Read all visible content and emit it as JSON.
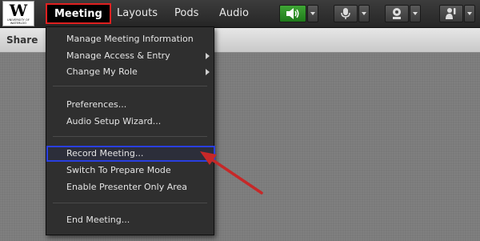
{
  "logo": {
    "letter": "W",
    "subtext": "UNIVERSITY OF WATERLOO"
  },
  "menubar": {
    "items": [
      {
        "label": "Meeting",
        "active": true
      },
      {
        "label": "Layouts"
      },
      {
        "label": "Pods"
      },
      {
        "label": "Audio"
      }
    ],
    "buttons": [
      {
        "name": "speaker-icon",
        "active": true
      },
      {
        "name": "microphone-icon"
      },
      {
        "name": "webcam-icon"
      },
      {
        "name": "raise-hand-icon"
      }
    ]
  },
  "pod": {
    "title": "Share"
  },
  "dropdown": {
    "items": [
      {
        "label": "Manage Meeting Information",
        "submenu": false
      },
      {
        "label": "Manage Access & Entry",
        "submenu": true
      },
      {
        "label": "Change My Role",
        "submenu": true
      },
      {
        "label": "Preferences...",
        "submenu": false
      },
      {
        "label": "Audio Setup Wizard...",
        "submenu": false
      },
      {
        "label": "Record Meeting...",
        "submenu": false,
        "highlighted": true
      },
      {
        "label": "Switch To Prepare Mode",
        "submenu": false
      },
      {
        "label": "Enable Presenter Only Area",
        "submenu": false
      },
      {
        "label": "End Meeting...",
        "submenu": false
      }
    ]
  },
  "colors": {
    "highlight_border": "#2a3fe0",
    "active_menu_border": "#e02020",
    "annotation_arrow": "#c62828",
    "audio_active": "#2e9a28"
  }
}
